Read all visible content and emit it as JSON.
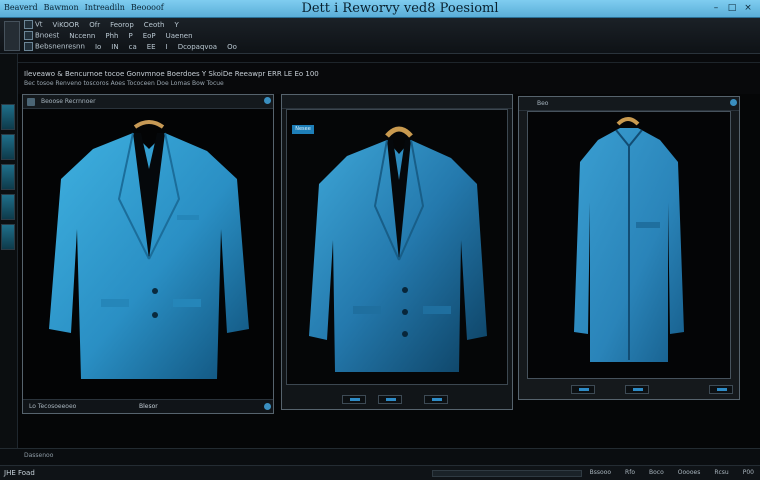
{
  "titlebar": {
    "menu": [
      "Beaverd",
      "Bawmon",
      "Intreadiln",
      "Beoooof"
    ],
    "title": "Dett i Reworvy ved8 Poesioml",
    "buttons": [
      "–",
      "□",
      "×"
    ]
  },
  "toolbar": {
    "row1": [
      "Vt",
      "ViKOOR",
      "Ofr",
      "Feorop",
      "Ceoth",
      "Y"
    ],
    "row2": [
      "Bnoest",
      "Nccenn",
      "Phh",
      "P",
      "EoP",
      "Uaenen"
    ],
    "row3": [
      "Bebsnenresnn",
      "Io",
      "IN",
      "ca",
      "EE",
      "I",
      "Dcopaqvoa",
      "Oo"
    ]
  },
  "subheader": {
    "line1": "Ileveawo & Bencurnoe tocoe Gonvmnoe  Boerdoes  Y SkoiDe  Reeawpr  ERR  LE Eo  100",
    "line2": "Bec tosoe Renveno toscoros Aoes Tococeen Doe Lomas Bow Tocue"
  },
  "panels": [
    {
      "header": "Beoose Recrnnoer",
      "foot_label": "Lo Tecosoeeoeo",
      "foot_value": "Blesor"
    },
    {
      "header": "",
      "tab": "Nesee",
      "foot_label": "",
      "foot_value": ""
    },
    {
      "header": "Beo",
      "foot_label": "",
      "foot_value": ""
    }
  ],
  "status": {
    "label_top": "Dassenoo",
    "label_bottom": "JHE Foad",
    "items": [
      "Bssooo",
      "Rfo",
      "Boco",
      "Ooooes",
      "Rcsu",
      "P00"
    ]
  },
  "colors": {
    "accent": "#5aaed8",
    "jacket_blue": "#2e9bd0",
    "background": "#050607"
  }
}
